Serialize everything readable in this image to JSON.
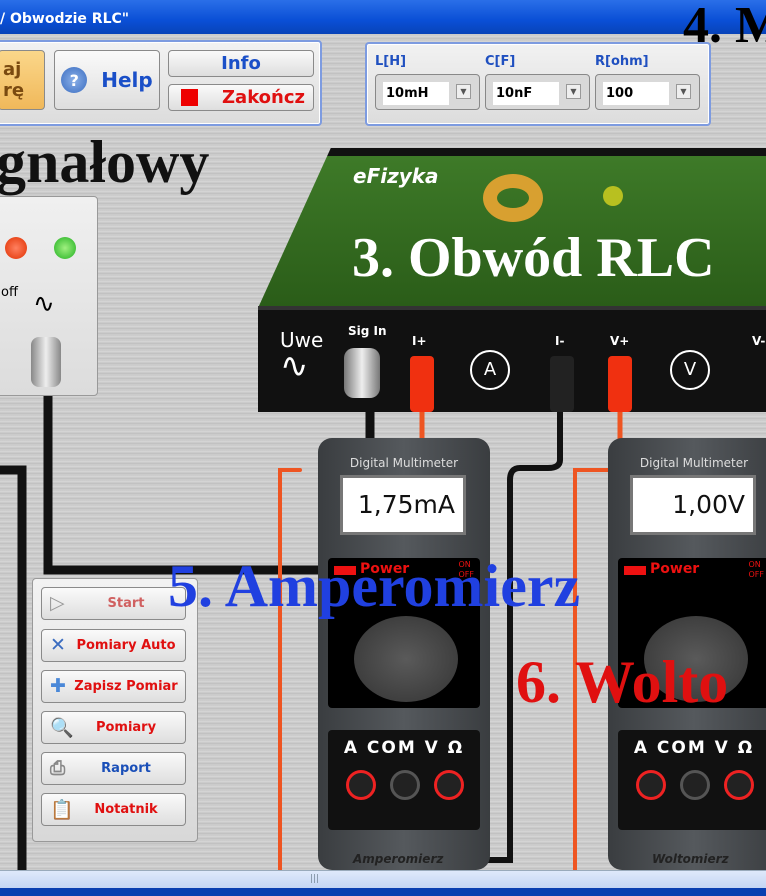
{
  "window": {
    "title": "/ Obwodzie RLC\""
  },
  "toolbar": {
    "orange_line1": "aj",
    "orange_line2": "rę",
    "help": "Help",
    "info": "Info",
    "quit": "Zakończ"
  },
  "params": {
    "L": {
      "label": "L[H]",
      "value": "10mH"
    },
    "C": {
      "label": "C[F]",
      "value": "10nF"
    },
    "R": {
      "label": "R[ohm]",
      "value": "100"
    }
  },
  "labels": {
    "top_right": "4. M",
    "generator": "gnałowy",
    "rlc": "3. Obwód RLC",
    "ammeter": "5. Amperomierz",
    "voltmeter": "6. Wolto"
  },
  "generator_box": {
    "off": "off"
  },
  "board": {
    "uwe": "Uwe",
    "sig_in": "Sig In",
    "i_plus": "I+",
    "i_minus": "I-",
    "v_plus": "V+",
    "v_minus": "V-",
    "a_symbol": "A",
    "v_symbol": "V",
    "logo": "eFizyka"
  },
  "meters": [
    {
      "header": "Digital Multimeter",
      "display": "1,75mA",
      "power": "Power",
      "on": "ON",
      "off": "OFF",
      "jacks": "A COM V Ω",
      "caption": "Amperomierz"
    },
    {
      "header": "Digital Multimeter",
      "display": "1,00V",
      "power": "Power",
      "on": "ON",
      "off": "OFF",
      "jacks": "A COM V Ω",
      "caption": "Woltomierz"
    }
  ],
  "side_buttons": [
    {
      "label": "Start",
      "icon": "play-icon",
      "color": "#d06060"
    },
    {
      "label": "Pomiary Auto",
      "icon": "tools-icon",
      "color": "#e01010"
    },
    {
      "label": "Zapisz Pomiar",
      "icon": "plus-icon",
      "color": "#e01010"
    },
    {
      "label": "Pomiary",
      "icon": "magnifier-icon",
      "color": "#e01010"
    },
    {
      "label": "Raport",
      "icon": "printer-icon",
      "color": "#1a4fb8"
    },
    {
      "label": "Notatnik",
      "icon": "clipboard-icon",
      "color": "#e01010"
    }
  ],
  "colors": {
    "accent_blue": "#2040e0",
    "accent_red": "#e01010",
    "pcb_green": "#2f6a1e"
  }
}
